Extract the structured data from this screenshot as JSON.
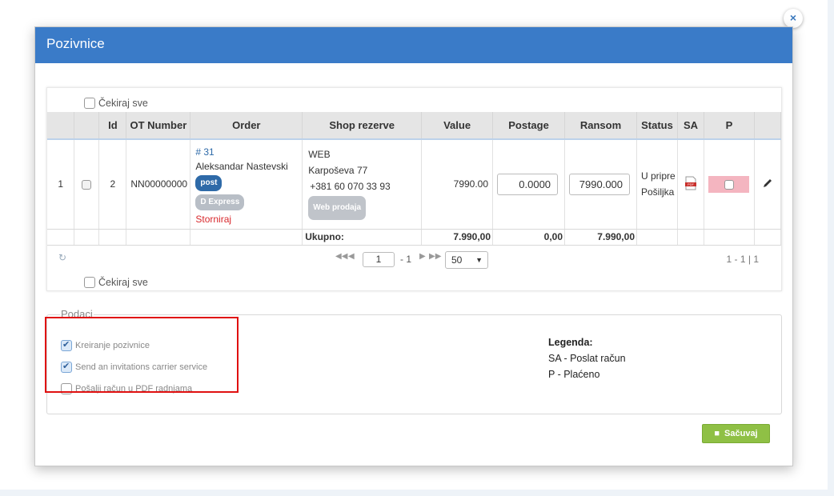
{
  "modal": {
    "title": "Pozivnice",
    "close_label": "×"
  },
  "grid": {
    "check_all_label": "Čekiraj sve",
    "columns": [
      "Id",
      "OT Number",
      "Order",
      "Shop rezerve",
      "Value",
      "Postage",
      "Ransom",
      "Status",
      "SA",
      "P"
    ],
    "row": {
      "index": "1",
      "id": "2",
      "ot_number": "NN00000000",
      "order_number": "# 31",
      "customer": "Aleksandar Nastevski",
      "badge_post": "post",
      "badge_express": "D Express",
      "storniraj": "Storniraj",
      "shop_name": "WEB",
      "shop_address": "Karpoševa 77",
      "shop_phone": "+381 60 070 33 93",
      "badge_web": "Web prodaja",
      "value": "7990.00",
      "postage": "0.0000",
      "ransom": "7990.000",
      "status_line1": "U pripre",
      "status_line2": "Pošiljka",
      "sa_icon": "pdf-icon",
      "edit_icon": "pencil-icon"
    },
    "summary": {
      "label": "Ukupno:",
      "value": "7.990,00",
      "postage": "0,00",
      "ransom": "7.990,00"
    },
    "pager": {
      "page": "1",
      "of_pages": "- 1",
      "page_size": "50",
      "range": "1 - 1 | 1"
    }
  },
  "options": {
    "title": "Podaci",
    "items": [
      {
        "label": "Kreiranje pozivnice",
        "checked": true
      },
      {
        "label": "Send an invitations carrier service",
        "checked": true
      },
      {
        "label": "Pošalji račun u PDF radnjama",
        "checked": false
      }
    ],
    "legend": {
      "title": "Legenda:",
      "line1": "SA - Poslat račun",
      "line2": "P - Plaćeno"
    }
  },
  "actions": {
    "save_label": "Sačuvaj"
  },
  "colors": {
    "header": "#3a7bc8",
    "save": "#8fc045",
    "highlight": "#e01010",
    "unpaid": "#f4b5c0"
  }
}
